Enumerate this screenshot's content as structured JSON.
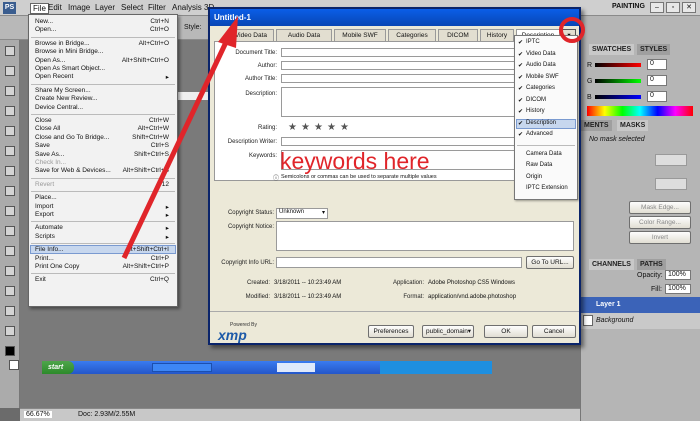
{
  "menubar": {
    "app_icon": "PS",
    "items": [
      "File",
      "Edit",
      "Image",
      "Layer",
      "Select",
      "Filter",
      "Analysis",
      "3D"
    ],
    "workspace": "PAINTING"
  },
  "options_bar": {
    "style_label": "Style:"
  },
  "file_menu": {
    "items": [
      {
        "label": "New...",
        "shortcut": "Ctrl+N"
      },
      {
        "label": "Open...",
        "shortcut": "Ctrl+O"
      },
      {
        "label": "Browse in Bridge...",
        "shortcut": "Alt+Ctrl+O"
      },
      {
        "label": "Browse in Mini Bridge...",
        "shortcut": ""
      },
      {
        "label": "Open As...",
        "shortcut": "Alt+Shift+Ctrl+O"
      },
      {
        "label": "Open As Smart Object...",
        "shortcut": ""
      },
      {
        "label": "Open Recent",
        "shortcut": ""
      },
      {
        "label": "Share My Screen...",
        "shortcut": ""
      },
      {
        "label": "Create New Review...",
        "shortcut": ""
      },
      {
        "label": "Device Central...",
        "shortcut": ""
      },
      {
        "label": "Close",
        "shortcut": "Ctrl+W"
      },
      {
        "label": "Close All",
        "shortcut": "Alt+Ctrl+W"
      },
      {
        "label": "Close and Go To Bridge...",
        "shortcut": "Shift+Ctrl+W"
      },
      {
        "label": "Save",
        "shortcut": "Ctrl+S"
      },
      {
        "label": "Save As...",
        "shortcut": "Shift+Ctrl+S"
      },
      {
        "label": "Check In...",
        "shortcut": ""
      },
      {
        "label": "Save for Web & Devices...",
        "shortcut": "Alt+Shift+Ctrl+S"
      },
      {
        "label": "Revert",
        "shortcut": "F12"
      },
      {
        "label": "Place...",
        "shortcut": ""
      },
      {
        "label": "Import",
        "shortcut": ""
      },
      {
        "label": "Export",
        "shortcut": ""
      },
      {
        "label": "Automate",
        "shortcut": ""
      },
      {
        "label": "Scripts",
        "shortcut": ""
      },
      {
        "label": "File Info...",
        "shortcut": "Alt+Shift+Ctrl+I"
      },
      {
        "label": "Print...",
        "shortcut": "Ctrl+P"
      },
      {
        "label": "Print One Copy",
        "shortcut": "Alt+Shift+Ctrl+P"
      },
      {
        "label": "Exit",
        "shortcut": "Ctrl+Q"
      }
    ]
  },
  "dialog": {
    "title": "Untitled-1",
    "tabs": [
      "Video Data",
      "Audio Data",
      "Mobile SWF",
      "Categories",
      "DICOM",
      "History",
      "Description"
    ],
    "fields": {
      "document_title": "Document Title:",
      "author": "Author:",
      "author_title": "Author Title:",
      "description": "Description:",
      "rating": "Rating:",
      "description_writer": "Description Writer:",
      "keywords": "Keywords:",
      "hint": "Semicolons or commas can be used to separate multiple values",
      "copyright_status": "Copyright Status:",
      "copyright_status_value": "Unknown",
      "copyright_notice": "Copyright Notice:",
      "copyright_url": "Copyright Info URL:",
      "goto_url": "Go To URL..."
    },
    "annotation": "keywords here",
    "info": {
      "created_label": "Created:",
      "created": "3/18/2011 -- 10:23:49 AM",
      "modified_label": "Modified:",
      "modified": "3/18/2011 -- 10:23:49 AM",
      "application_label": "Application:",
      "application": "Adobe Photoshop CS5 Windows",
      "format_label": "Format:",
      "format": "application/vnd.adobe.photoshop"
    },
    "powered_by": "Powered By",
    "xmp": "xmp",
    "buttons": {
      "preferences": "Preferences",
      "template": "public_domain",
      "ok": "OK",
      "cancel": "Cancel"
    }
  },
  "dropdown": {
    "checked_items": [
      "IPTC",
      "Video Data",
      "Audio Data",
      "Mobile SWF",
      "Categories",
      "DICOM",
      "History",
      "Description",
      "Advanced"
    ],
    "unchecked_items": [
      "Camera Data",
      "Raw Data",
      "Origin",
      "IPTC Extension"
    ]
  },
  "right_panel": {
    "tabs_top": [
      "SWATCHES",
      "STYLES"
    ],
    "color_labels": [
      "R",
      "G",
      "B"
    ],
    "color_values": [
      "0",
      "0",
      "0"
    ],
    "tabs_mid": [
      "MENTS",
      "MASKS"
    ],
    "mask_status": "No mask selected",
    "mask_buttons": [
      "Mask Edge...",
      "Color Range...",
      "Invert"
    ],
    "tabs_layers": [
      "CHANNELS",
      "PATHS"
    ],
    "opacity_label": "Opacity:",
    "opacity": "100%",
    "fill_label": "Fill:",
    "fill": "100%",
    "layers": [
      "Layer 1",
      "Background"
    ]
  },
  "status_bar": {
    "zoom": "66.67%",
    "doc": "Doc: 2.93M/2.55M"
  },
  "taskbar": {
    "start": "start"
  },
  "colors": {
    "accent": "#0a5ee8",
    "annotation": "#e0252a",
    "title_bar": "#0846b4"
  }
}
